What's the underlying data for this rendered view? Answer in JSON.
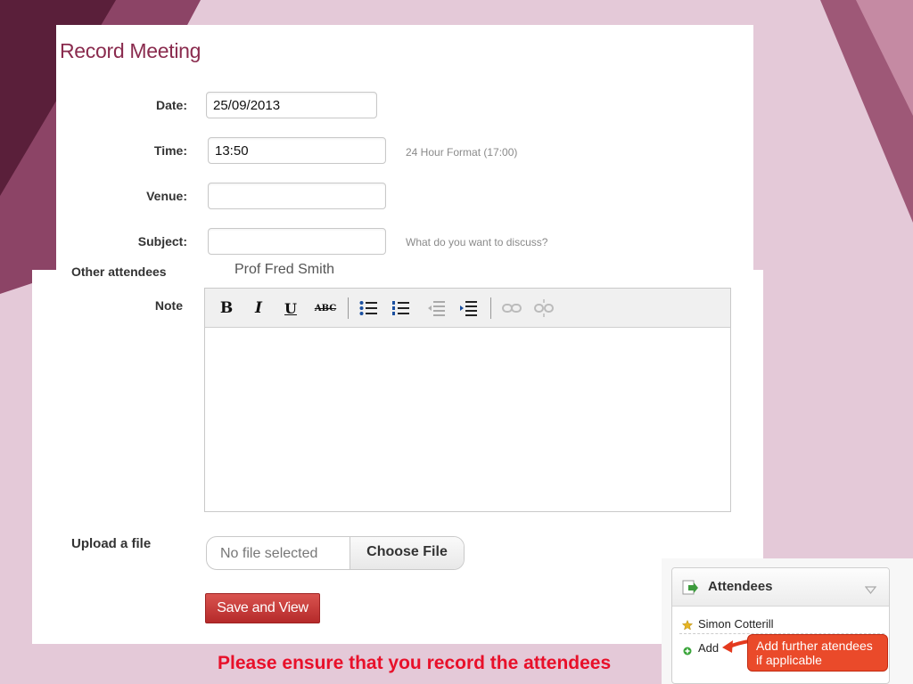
{
  "form": {
    "title": "Record Meeting",
    "date_label": "Date:",
    "date_value": "25/09/2013",
    "time_label": "Time:",
    "time_value": "13:50",
    "time_hint": "24 Hour Format (17:00)",
    "venue_label": "Venue:",
    "venue_value": "",
    "subject_label": "Subject:",
    "subject_value": "",
    "subject_hint": "What do you want to discuss?",
    "other_attendees_label": "Other attendees",
    "other_attendees_value": "Prof Fred Smith",
    "note_label": "Note",
    "upload_label": "Upload a file",
    "file_status": "No file selected",
    "choose_file_label": "Choose File",
    "save_label": "Save and View"
  },
  "editor": {
    "toolbar": {
      "bold": "B",
      "italic": "I",
      "underline": "U",
      "strike": "ABC"
    },
    "content": ""
  },
  "attendees": {
    "title": "Attendees",
    "items": [
      "Simon Cotterill"
    ],
    "add_label": "Add"
  },
  "callout": {
    "line1": "Add further atendees",
    "line2": "if applicable"
  },
  "footer": {
    "note": "Please ensure that you record the attendees"
  },
  "colors": {
    "title": "#8a2b4e",
    "save_button": "#c9302c",
    "footer_note": "#e8102a",
    "callout": "#ea4a2a"
  }
}
